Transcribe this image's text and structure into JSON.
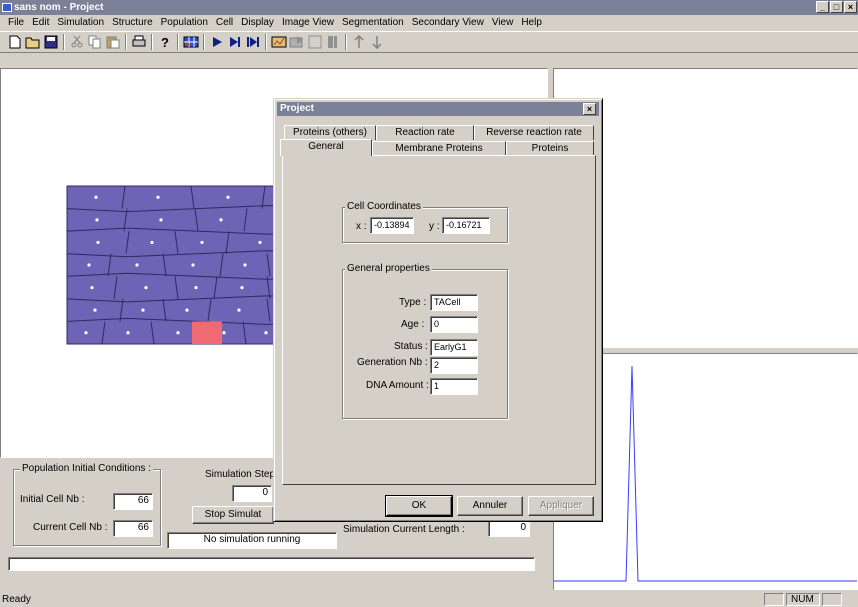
{
  "window": {
    "title": "sans nom - Project"
  },
  "menu": [
    "File",
    "Edit",
    "Simulation",
    "Structure",
    "Population",
    "Cell",
    "Display",
    "Image View",
    "Segmentation",
    "Secondary View",
    "View",
    "Help"
  ],
  "toolbar_icons": [
    "new-icon",
    "open-icon",
    "save-icon",
    "cut-icon",
    "copy-icon",
    "paste-icon",
    "print-icon",
    "help-icon",
    "grid-icon",
    "play-icon",
    "step-icon",
    "step-end-icon",
    "chart-icon",
    "export-icon",
    "frame-icon",
    "bar-icon",
    "arrow-up-icon",
    "arrow-down-icon"
  ],
  "bottom_panel": {
    "population_group": "Population Initial Conditions :",
    "initial_cell_label": "Initial Cell Nb :",
    "initial_cell_value": "66",
    "current_cell_label": "Current Cell Nb :",
    "current_cell_value": "66",
    "simulation_step_label": "Simulation Step",
    "simulation_step_value": "0",
    "stop_button": "Stop Simulat",
    "status_text": "No simulation running",
    "current_length_label": "Simulation Current Length :",
    "current_length_value": "0"
  },
  "dialog": {
    "title": "Project",
    "tabs_row1": [
      "Proteins (others)",
      "Reaction rate",
      "Reverse reaction rate"
    ],
    "tabs_row2": [
      "General",
      "Membrane Proteins",
      "Proteins"
    ],
    "active_tab": "General",
    "cell_coords": {
      "title": "Cell Coordinates",
      "x_label": "x :",
      "x_value": "-0.13894",
      "y_label": "y :",
      "y_value": "-0.16721"
    },
    "general": {
      "title": "General properties",
      "type_label": "Type :",
      "type_value": "TACell",
      "age_label": "Age :",
      "age_value": "0",
      "status_label": "Status :",
      "status_value": "EarlyG1",
      "gen_label": "Generation Nb :",
      "gen_value": "2",
      "dna_label": "DNA Amount :",
      "dna_value": "1"
    },
    "ok": "OK",
    "cancel": "Annuler",
    "apply": "Appliquer"
  },
  "statusbar": {
    "text": "Ready",
    "num": "NUM"
  },
  "colors": {
    "cells": "#6f63b6",
    "cell_border": "#2f2a60",
    "selected_cell": "#f06a73",
    "plot": "#3a3aff"
  }
}
